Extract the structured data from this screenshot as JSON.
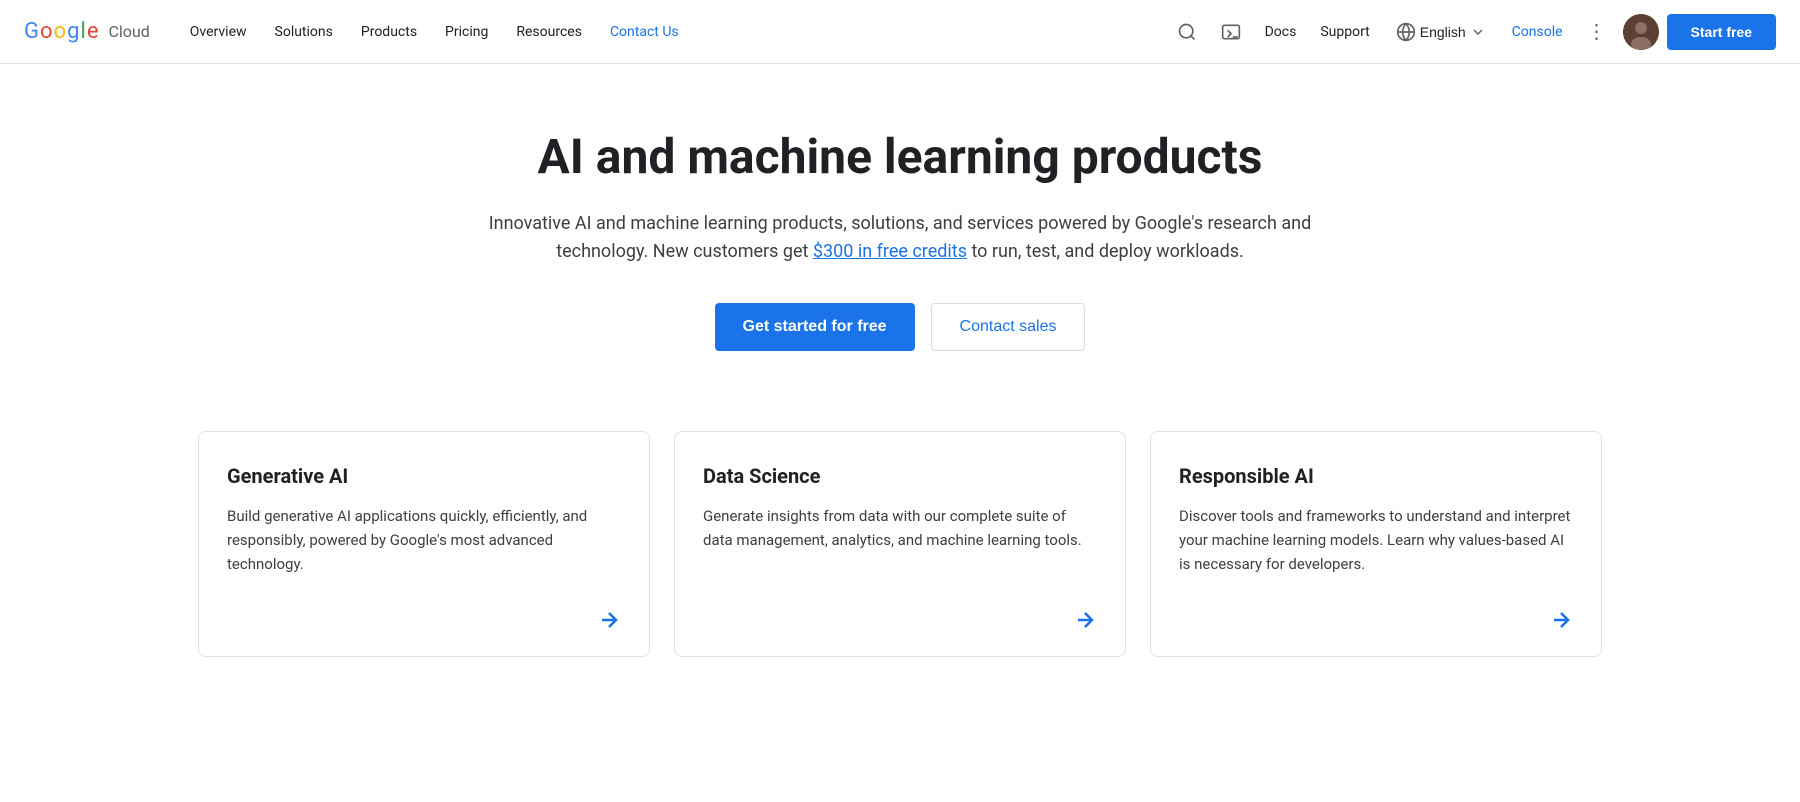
{
  "nav": {
    "logo_google": "Google",
    "logo_cloud": "Cloud",
    "links": [
      {
        "label": "Overview",
        "active": false
      },
      {
        "label": "Solutions",
        "active": false
      },
      {
        "label": "Products",
        "active": false
      },
      {
        "label": "Pricing",
        "active": false
      },
      {
        "label": "Resources",
        "active": false
      },
      {
        "label": "Contact Us",
        "active": true
      }
    ],
    "docs_label": "Docs",
    "support_label": "Support",
    "lang_label": "English",
    "console_label": "Console",
    "start_free_label": "Start free"
  },
  "hero": {
    "title": "AI and machine learning products",
    "desc_before": "Innovative AI and machine learning products, solutions, and services powered by Google's research and technology. New customers get ",
    "free_credits_link": "$300 in free credits",
    "desc_after": " to run, test, and deploy workloads.",
    "btn_primary": "Get started for free",
    "btn_secondary": "Contact sales"
  },
  "cards": [
    {
      "title": "Generative AI",
      "desc": "Build generative AI applications quickly, efficiently, and responsibly, powered by Google's most advanced technology."
    },
    {
      "title": "Data Science",
      "desc": "Generate insights from data with our complete suite of data management, analytics, and machine learning tools."
    },
    {
      "title": "Responsible AI",
      "desc": "Discover tools and frameworks to understand and interpret your machine learning models. Learn why values-based AI is necessary for developers."
    }
  ]
}
